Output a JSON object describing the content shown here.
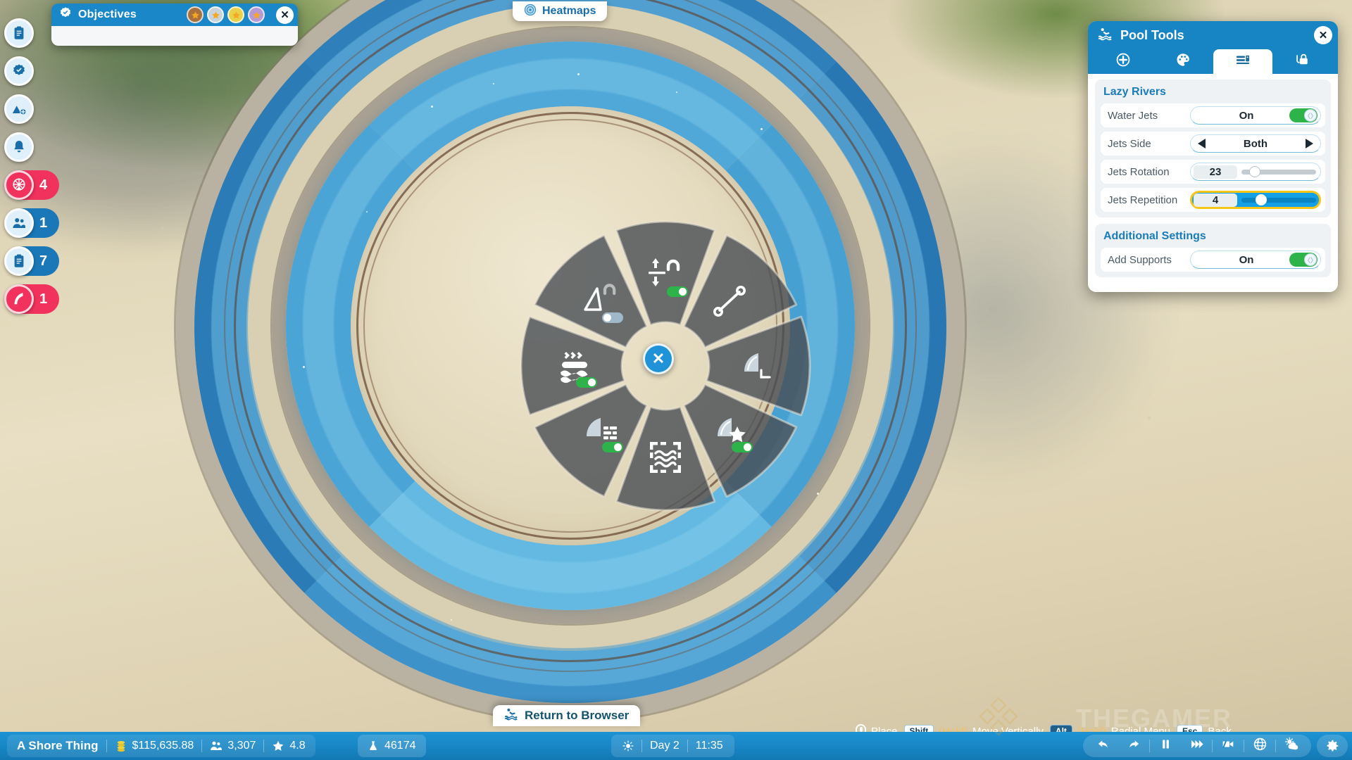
{
  "app": {
    "title": "Pool Tools"
  },
  "sidebar": {
    "items": [
      {
        "name": "clipboard-tasks",
        "icon": "clipboard-icon",
        "count": "",
        "style": "plain"
      },
      {
        "name": "objectives-check",
        "icon": "check-badge-icon",
        "count": "",
        "style": "plain"
      },
      {
        "name": "add-terrain",
        "icon": "mountain-add-icon",
        "count": "",
        "style": "plain"
      },
      {
        "name": "notifications",
        "icon": "bell-icon",
        "count": "",
        "style": "plain"
      },
      {
        "name": "rides-alerts",
        "icon": "ferris-wheel-icon",
        "count": "4",
        "style": "red"
      },
      {
        "name": "staff",
        "icon": "people-icon",
        "count": "1",
        "style": "blue"
      },
      {
        "name": "reports",
        "icon": "clipboard-icon",
        "count": "7",
        "style": "blue"
      },
      {
        "name": "slides-alerts",
        "icon": "water-slide-icon",
        "count": "1",
        "style": "red"
      }
    ]
  },
  "objectives": {
    "title": "Objectives",
    "icon": "check-badge-icon",
    "close_label": "✕",
    "medals": [
      {
        "tier": "bronze",
        "color": "#a8703c"
      },
      {
        "tier": "silver",
        "color": "#c8d4dc"
      },
      {
        "tier": "gold",
        "color": "#e9d24a"
      },
      {
        "tier": "platinum",
        "color": "#b59ad6"
      }
    ]
  },
  "heatmaps": {
    "label": "Heatmaps",
    "icon": "heatmap-circle-icon"
  },
  "return_to_browser": {
    "label": "Return to Browser",
    "icon": "pool-swimmer-icon"
  },
  "radial_menu": {
    "center_label": "✕",
    "segments": [
      {
        "name": "vertical-snap",
        "icon": "vertical-snap-magnet-icon",
        "toggle": "on"
      },
      {
        "name": "path-line",
        "icon": "line-nodes-icon",
        "toggle": "none"
      },
      {
        "name": "slope-end",
        "icon": "slope-corner-icon",
        "toggle": "none"
      },
      {
        "name": "slope-favorite",
        "icon": "slope-star-icon",
        "toggle": "on"
      },
      {
        "name": "water-select",
        "icon": "water-marquee-icon",
        "toggle": "none"
      },
      {
        "name": "slope-settings",
        "icon": "slope-list-icon",
        "toggle": "on"
      },
      {
        "name": "water-current",
        "icon": "water-current-icon",
        "toggle": "on"
      },
      {
        "name": "angle-snap",
        "icon": "angle-snap-magnet-icon",
        "toggle": "off"
      }
    ]
  },
  "pool_tools": {
    "title": "Pool Tools",
    "title_icon": "pool-swimmer-icon",
    "close_label": "✕",
    "tabs": [
      {
        "name": "tab-add",
        "icon": "plus-circle-icon",
        "selected": false
      },
      {
        "name": "tab-paint",
        "icon": "palette-icon",
        "selected": false
      },
      {
        "name": "tab-settings",
        "icon": "sliders-icon",
        "selected": true
      },
      {
        "name": "tab-lock",
        "icon": "lock-icon",
        "selected": false
      }
    ],
    "groups": [
      {
        "title": "Lazy Rivers",
        "rows": [
          {
            "label": "Water Jets",
            "type": "toggle",
            "value": "On",
            "state": "on"
          },
          {
            "label": "Jets Side",
            "type": "stepper",
            "value": "Both"
          },
          {
            "label": "Jets Rotation",
            "type": "slider",
            "value": "23",
            "percent": 18,
            "highlighted": false
          },
          {
            "label": "Jets Repetition",
            "type": "slider",
            "value": "4",
            "percent": 26,
            "highlighted": true
          }
        ]
      },
      {
        "title": "Additional Settings",
        "rows": [
          {
            "label": "Add Supports",
            "type": "toggle",
            "value": "On",
            "state": "on"
          }
        ]
      }
    ]
  },
  "hints": [
    {
      "icon": "mouse-left-icon",
      "key": "",
      "hold": "",
      "action": "Place"
    },
    {
      "icon": "",
      "key": "Shift",
      "hold": "(Hold)",
      "action": "Move Vertically"
    },
    {
      "icon": "",
      "key": "Alt",
      "hold": "(Hold)",
      "action": "Radial Menu"
    },
    {
      "icon": "",
      "key": "Esc",
      "hold": "",
      "action": "Back"
    }
  ],
  "status_bar": {
    "park_name": "A Shore Thing",
    "stats": [
      {
        "name": "money",
        "icon": "coins-icon",
        "value": "$115,635.88"
      },
      {
        "name": "guests",
        "icon": "guests-icon",
        "value": "3,307"
      },
      {
        "name": "park-rating",
        "icon": "star-icon",
        "value": "4.8"
      }
    ],
    "research": {
      "icon": "flask-icon",
      "value": "46174"
    },
    "time": {
      "icon": "sun-icon",
      "day": "Day 2",
      "clock": "11:35"
    },
    "controls": [
      {
        "name": "undo-button",
        "icon": "undo-icon"
      },
      {
        "name": "redo-button",
        "icon": "redo-icon"
      },
      {
        "name": "pause-button",
        "icon": "pause-icon"
      },
      {
        "name": "fast-forward-button",
        "icon": "fast-forward-icon"
      },
      {
        "name": "camera-button",
        "icon": "camera-icon"
      },
      {
        "name": "globe-button",
        "icon": "globe-icon"
      },
      {
        "name": "weather-button",
        "icon": "weather-icon"
      }
    ],
    "settings": {
      "name": "settings-button",
      "icon": "gear-icon"
    }
  },
  "watermark": {
    "text": "THEGAMER"
  },
  "colors": {
    "accent_blue": "#1785c4",
    "panel_blue": "#1a88c8",
    "toggle_green": "#2db34a",
    "highlight_yellow": "#f5c518",
    "badge_red": "#f0325c",
    "badge_blue": "#1a78b8"
  }
}
